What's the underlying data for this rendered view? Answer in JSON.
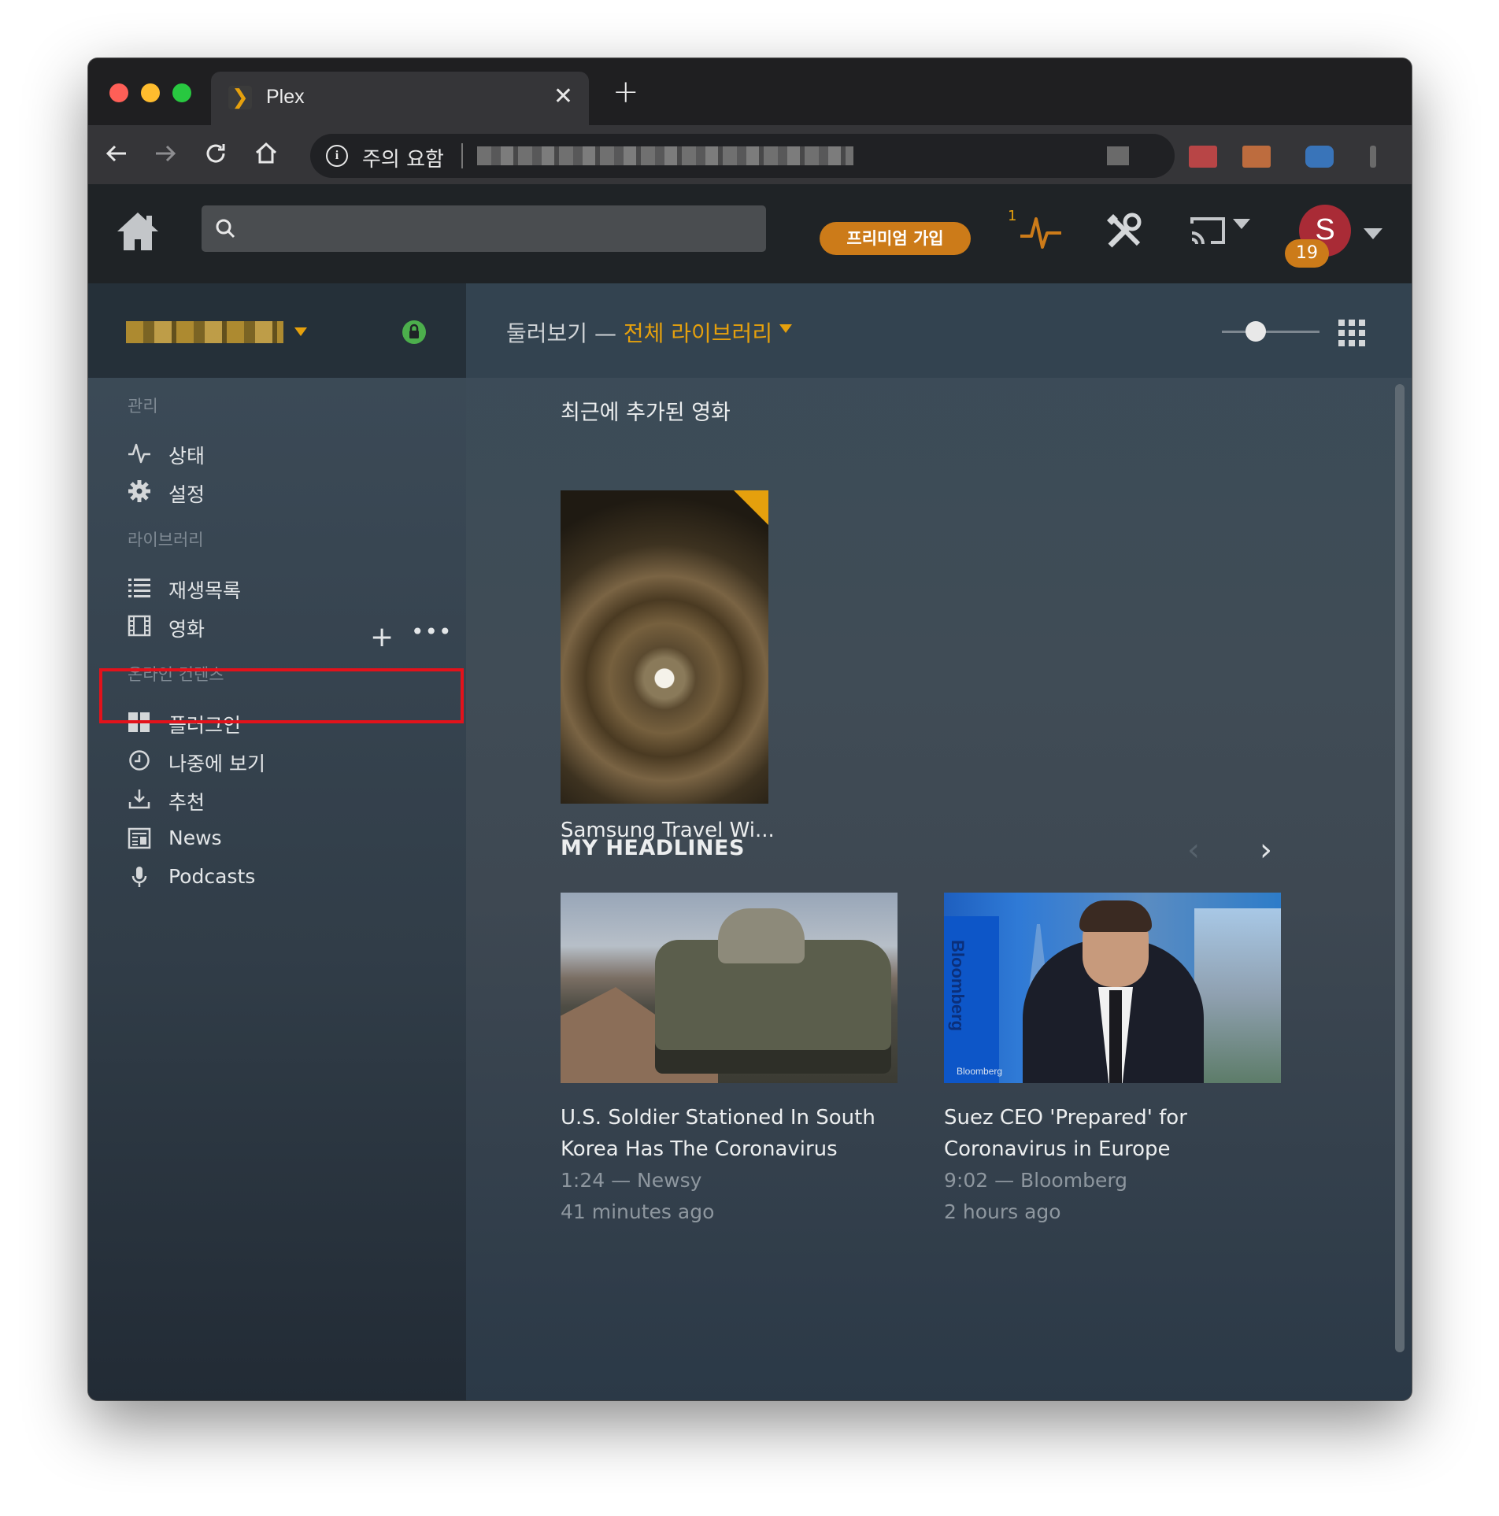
{
  "browser": {
    "tab_title": "Plex",
    "tab_close": "✕",
    "new_tab": "+",
    "security_label": "주의 요함"
  },
  "header": {
    "premium_label": "프리미엄 가입",
    "activity_count": "1",
    "avatar_initial": "S",
    "avatar_badge": "19"
  },
  "sidebar": {
    "manage_section": "관리",
    "manage_items": [
      {
        "label": "상태",
        "icon": "activity-icon"
      },
      {
        "label": "설정",
        "icon": "gear-icon"
      }
    ],
    "library_section": "라이브러리",
    "library_add": "+",
    "library_more": "•••",
    "library_items": [
      {
        "label": "재생목록",
        "icon": "list-icon"
      },
      {
        "label": "영화",
        "icon": "film-icon"
      }
    ],
    "online_section": "온라인 컨텐츠",
    "online_items": [
      {
        "label": "플러그인",
        "icon": "plugins-icon"
      },
      {
        "label": "나중에 보기",
        "icon": "clock-icon"
      },
      {
        "label": "추천",
        "icon": "download-icon"
      },
      {
        "label": "News",
        "icon": "news-icon"
      },
      {
        "label": "Podcasts",
        "icon": "microphone-icon"
      }
    ]
  },
  "main": {
    "breadcrumb_prefix": "둘러보기 —",
    "breadcrumb_library": "전체 라이브러리",
    "recent_title": "최근에 추가된 영화",
    "recent_items": [
      {
        "title": "Samsung Travel Wi..."
      }
    ],
    "headlines_title": "MY HEADLINES",
    "prev_arrow": "‹",
    "next_arrow": "›",
    "headlines": [
      {
        "title": "U.S. Soldier Stationed In South Korea Has The Coronavirus",
        "meta": "1:24 — Newsy",
        "time": "41 minutes ago"
      },
      {
        "title": "Suez CEO 'Prepared' for Coronavirus in Europe",
        "meta": "9:02 — Bloomberg",
        "time": "2 hours ago",
        "thumb_brand": "Bloomberg",
        "thumb_watermark": "Bloomberg"
      }
    ]
  },
  "colors": {
    "accent": "#e5a00d",
    "premium": "#cc7b19",
    "highlight": "#e3121b",
    "avatar": "#a92b36"
  }
}
